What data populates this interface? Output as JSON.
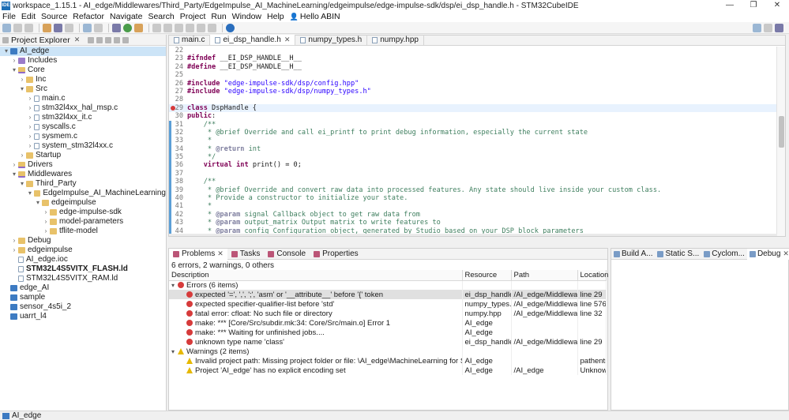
{
  "window": {
    "title": "workspace_1.15.1 - AI_edge/Middlewares/Third_Party/EdgeImpulse_AI_MachineLearning/edgeimpulse/edge-impulse-sdk/dsp/ei_dsp_handle.h - STM32CubeIDE",
    "app_icon_text": "IDE",
    "controls": [
      "—",
      "❐",
      "✕"
    ]
  },
  "menu": {
    "items": [
      "File",
      "Edit",
      "Source",
      "Refactor",
      "Navigate",
      "Search",
      "Project",
      "Run",
      "Window",
      "Help"
    ],
    "user": "Hello ABIN"
  },
  "explorer": {
    "tab_label": "Project Explorer",
    "tree": [
      {
        "label": "AI_edge",
        "depth": 0,
        "arrow": "▾",
        "icon": "proj",
        "selected": true
      },
      {
        "label": "Includes",
        "depth": 1,
        "arrow": "›",
        "icon": "inc"
      },
      {
        "label": "Core",
        "depth": 1,
        "arrow": "▾",
        "icon": "srcfolder"
      },
      {
        "label": "Inc",
        "depth": 2,
        "arrow": "›",
        "icon": "folder"
      },
      {
        "label": "Src",
        "depth": 2,
        "arrow": "▾",
        "icon": "folder"
      },
      {
        "label": "main.c",
        "depth": 3,
        "arrow": "›",
        "icon": "file"
      },
      {
        "label": "stm32l4xx_hal_msp.c",
        "depth": 3,
        "arrow": "›",
        "icon": "file"
      },
      {
        "label": "stm32l4xx_it.c",
        "depth": 3,
        "arrow": "›",
        "icon": "file"
      },
      {
        "label": "syscalls.c",
        "depth": 3,
        "arrow": "›",
        "icon": "file"
      },
      {
        "label": "sysmem.c",
        "depth": 3,
        "arrow": "›",
        "icon": "file"
      },
      {
        "label": "system_stm32l4xx.c",
        "depth": 3,
        "arrow": "›",
        "icon": "file"
      },
      {
        "label": "Startup",
        "depth": 2,
        "arrow": "›",
        "icon": "folder"
      },
      {
        "label": "Drivers",
        "depth": 1,
        "arrow": "›",
        "icon": "srcfolder"
      },
      {
        "label": "Middlewares",
        "depth": 1,
        "arrow": "▾",
        "icon": "srcfolder"
      },
      {
        "label": "Third_Party",
        "depth": 2,
        "arrow": "▾",
        "icon": "folder"
      },
      {
        "label": "EdgeImpulse_AI_MachineLearning",
        "depth": 3,
        "arrow": "▾",
        "icon": "folder"
      },
      {
        "label": "edgeimpulse",
        "depth": 4,
        "arrow": "▾",
        "icon": "folder"
      },
      {
        "label": "edge-impulse-sdk",
        "depth": 5,
        "arrow": "›",
        "icon": "folder"
      },
      {
        "label": "model-parameters",
        "depth": 5,
        "arrow": "›",
        "icon": "folder"
      },
      {
        "label": "tflite-model",
        "depth": 5,
        "arrow": "›",
        "icon": "folder"
      },
      {
        "label": "Debug",
        "depth": 1,
        "arrow": "›",
        "icon": "folder"
      },
      {
        "label": "edgeimpulse",
        "depth": 1,
        "arrow": "›",
        "icon": "folder"
      },
      {
        "label": "AI_edge.ioc",
        "depth": 1,
        "arrow": "",
        "icon": "file"
      },
      {
        "label": "STM32L4S5VITX_FLASH.ld",
        "depth": 1,
        "arrow": "",
        "icon": "file",
        "bold": true
      },
      {
        "label": "STM32L4S5VITX_RAM.ld",
        "depth": 1,
        "arrow": "",
        "icon": "file"
      },
      {
        "label": "edge_AI",
        "depth": 0,
        "arrow": "",
        "icon": "proj"
      },
      {
        "label": "sample",
        "depth": 0,
        "arrow": "",
        "icon": "proj"
      },
      {
        "label": "sensor_4s5i_2",
        "depth": 0,
        "arrow": "",
        "icon": "proj"
      },
      {
        "label": "uarrt_l4",
        "depth": 0,
        "arrow": "",
        "icon": "proj"
      }
    ]
  },
  "editor": {
    "tabs": [
      {
        "label": "main.c",
        "active": false
      },
      {
        "label": "ei_dsp_handle.h",
        "active": true
      },
      {
        "label": "numpy_types.h",
        "active": false
      },
      {
        "label": "numpy.hpp",
        "active": false
      }
    ],
    "lines": [
      {
        "n": "22",
        "html": ""
      },
      {
        "n": "23",
        "html": "<span class='kw'>#ifndef</span> __EI_DSP_HANDLE__H__"
      },
      {
        "n": "24",
        "html": "<span class='kw'>#define</span> __EI_DSP_HANDLE__H__"
      },
      {
        "n": "25",
        "html": ""
      },
      {
        "n": "26",
        "html": "<span class='kw'>#include</span> <span class='st'>\"edge-impulse-sdk/dsp/config.hpp\"</span>"
      },
      {
        "n": "27",
        "html": "<span class='kw'>#include</span> <span class='st'>\"edge-impulse-sdk/dsp/numpy_types.h\"</span>"
      },
      {
        "n": "28",
        "html": ""
      },
      {
        "n": "29",
        "html": "<span class='kw'>class</span> DspHandle {",
        "current": true,
        "error": true
      },
      {
        "n": "30",
        "html": "<span class='kw'>public</span>:"
      },
      {
        "n": "31",
        "html": "    <span class='cm'>/**</span>"
      },
      {
        "n": "32",
        "html": "<span class='cm'>     * @brief Override and call ei_printf to print debug information, especially the current state</span>"
      },
      {
        "n": "33",
        "html": "<span class='cm'>     *</span>"
      },
      {
        "n": "34",
        "html": "<span class='cm'>     * </span><span class='tag'>@return</span><span class='cm'> int</span>"
      },
      {
        "n": "35",
        "html": "<span class='cm'>     */</span>"
      },
      {
        "n": "36",
        "html": "    <span class='kw'>virtual</span> <span class='kw'>int</span> print() = 0;"
      },
      {
        "n": "37",
        "html": ""
      },
      {
        "n": "38",
        "html": "    <span class='cm'>/**</span>"
      },
      {
        "n": "39",
        "html": "<span class='cm'>     * @brief Override and convert raw data into processed features. Any state should live inside your custom class.</span>"
      },
      {
        "n": "40",
        "html": "<span class='cm'>     * Provide a constructor to initialize your state.</span>"
      },
      {
        "n": "41",
        "html": "<span class='cm'>     *</span>"
      },
      {
        "n": "42",
        "html": "<span class='cm'>     * </span><span class='tag'>@param</span><span class='cm'> signal Callback object to get raw data from</span>"
      },
      {
        "n": "43",
        "html": "<span class='cm'>     * </span><span class='tag'>@param</span><span class='cm'> output_matrix Output matrix to write features to</span>"
      },
      {
        "n": "44",
        "html": "<span class='cm'>     * </span><span class='tag'>@param</span><span class='cm'> config Configuration object, generated by Studio based on your DSP block parameters</span>"
      }
    ]
  },
  "problems": {
    "tabs": [
      {
        "label": "Problems",
        "active": true,
        "closable": true
      },
      {
        "label": "Tasks",
        "active": false,
        "closable": false
      },
      {
        "label": "Console",
        "active": false,
        "closable": false
      },
      {
        "label": "Properties",
        "active": false,
        "closable": false
      }
    ],
    "summary": "6 errors, 2 warnings, 0 others",
    "columns": [
      "Description",
      "Resource",
      "Path",
      "Location"
    ],
    "rows": [
      {
        "kind": "group",
        "icon": "error",
        "description": "Errors (6 items)",
        "resource": "",
        "path": "",
        "location": ""
      },
      {
        "kind": "error",
        "description": "expected '=', ',', ';', 'asm' or '__attribute__' before '{' token",
        "resource": "ei_dsp_handle.h",
        "path": "/AI_edge/Middlewar...",
        "location": "line 29",
        "selected": true
      },
      {
        "kind": "error",
        "description": "expected specifier-qualifier-list before 'std'",
        "resource": "numpy_types.h",
        "path": "/AI_edge/Middlewar...",
        "location": "line 576"
      },
      {
        "kind": "error",
        "description": "fatal error: cfloat: No such file or directory",
        "resource": "numpy.hpp",
        "path": "/AI_edge/Middlewar...",
        "location": "line 32"
      },
      {
        "kind": "error",
        "description": "make: *** [Core/Src/subdir.mk:34: Core/Src/main.o] Error 1",
        "resource": "AI_edge",
        "path": "",
        "location": ""
      },
      {
        "kind": "error",
        "description": "make: *** Waiting for unfinished jobs....",
        "resource": "AI_edge",
        "path": "",
        "location": ""
      },
      {
        "kind": "error",
        "description": "unknown type name 'class'",
        "resource": "ei_dsp_handle.h",
        "path": "/AI_edge/Middlewar...",
        "location": "line 29"
      },
      {
        "kind": "group",
        "icon": "warning",
        "description": "Warnings (2 items)",
        "resource": "",
        "path": "",
        "location": ""
      },
      {
        "kind": "warning",
        "description": "Invalid project path: Missing project folder or file: \\AI_edge\\MachineLearning for Source path.",
        "resource": "AI_edge",
        "path": "",
        "location": "pathentry"
      },
      {
        "kind": "warning",
        "description": "Project 'AI_edge' has no explicit encoding set",
        "resource": "AI_edge",
        "path": "/AI_edge",
        "location": "Unknown"
      }
    ]
  },
  "right_panel": {
    "tabs": [
      {
        "label": "Build A...",
        "active": false
      },
      {
        "label": "Static S...",
        "active": false
      },
      {
        "label": "Cyclom...",
        "active": false
      },
      {
        "label": "Debug",
        "active": true
      }
    ]
  },
  "status": {
    "text": "AI_edge"
  },
  "colors": {
    "selection": "#cce4f7",
    "error": "#d63b3b",
    "warning": "#e6b800",
    "keyword": "#7f0055",
    "comment": "#3f7f5f",
    "string": "#2a00ff"
  }
}
